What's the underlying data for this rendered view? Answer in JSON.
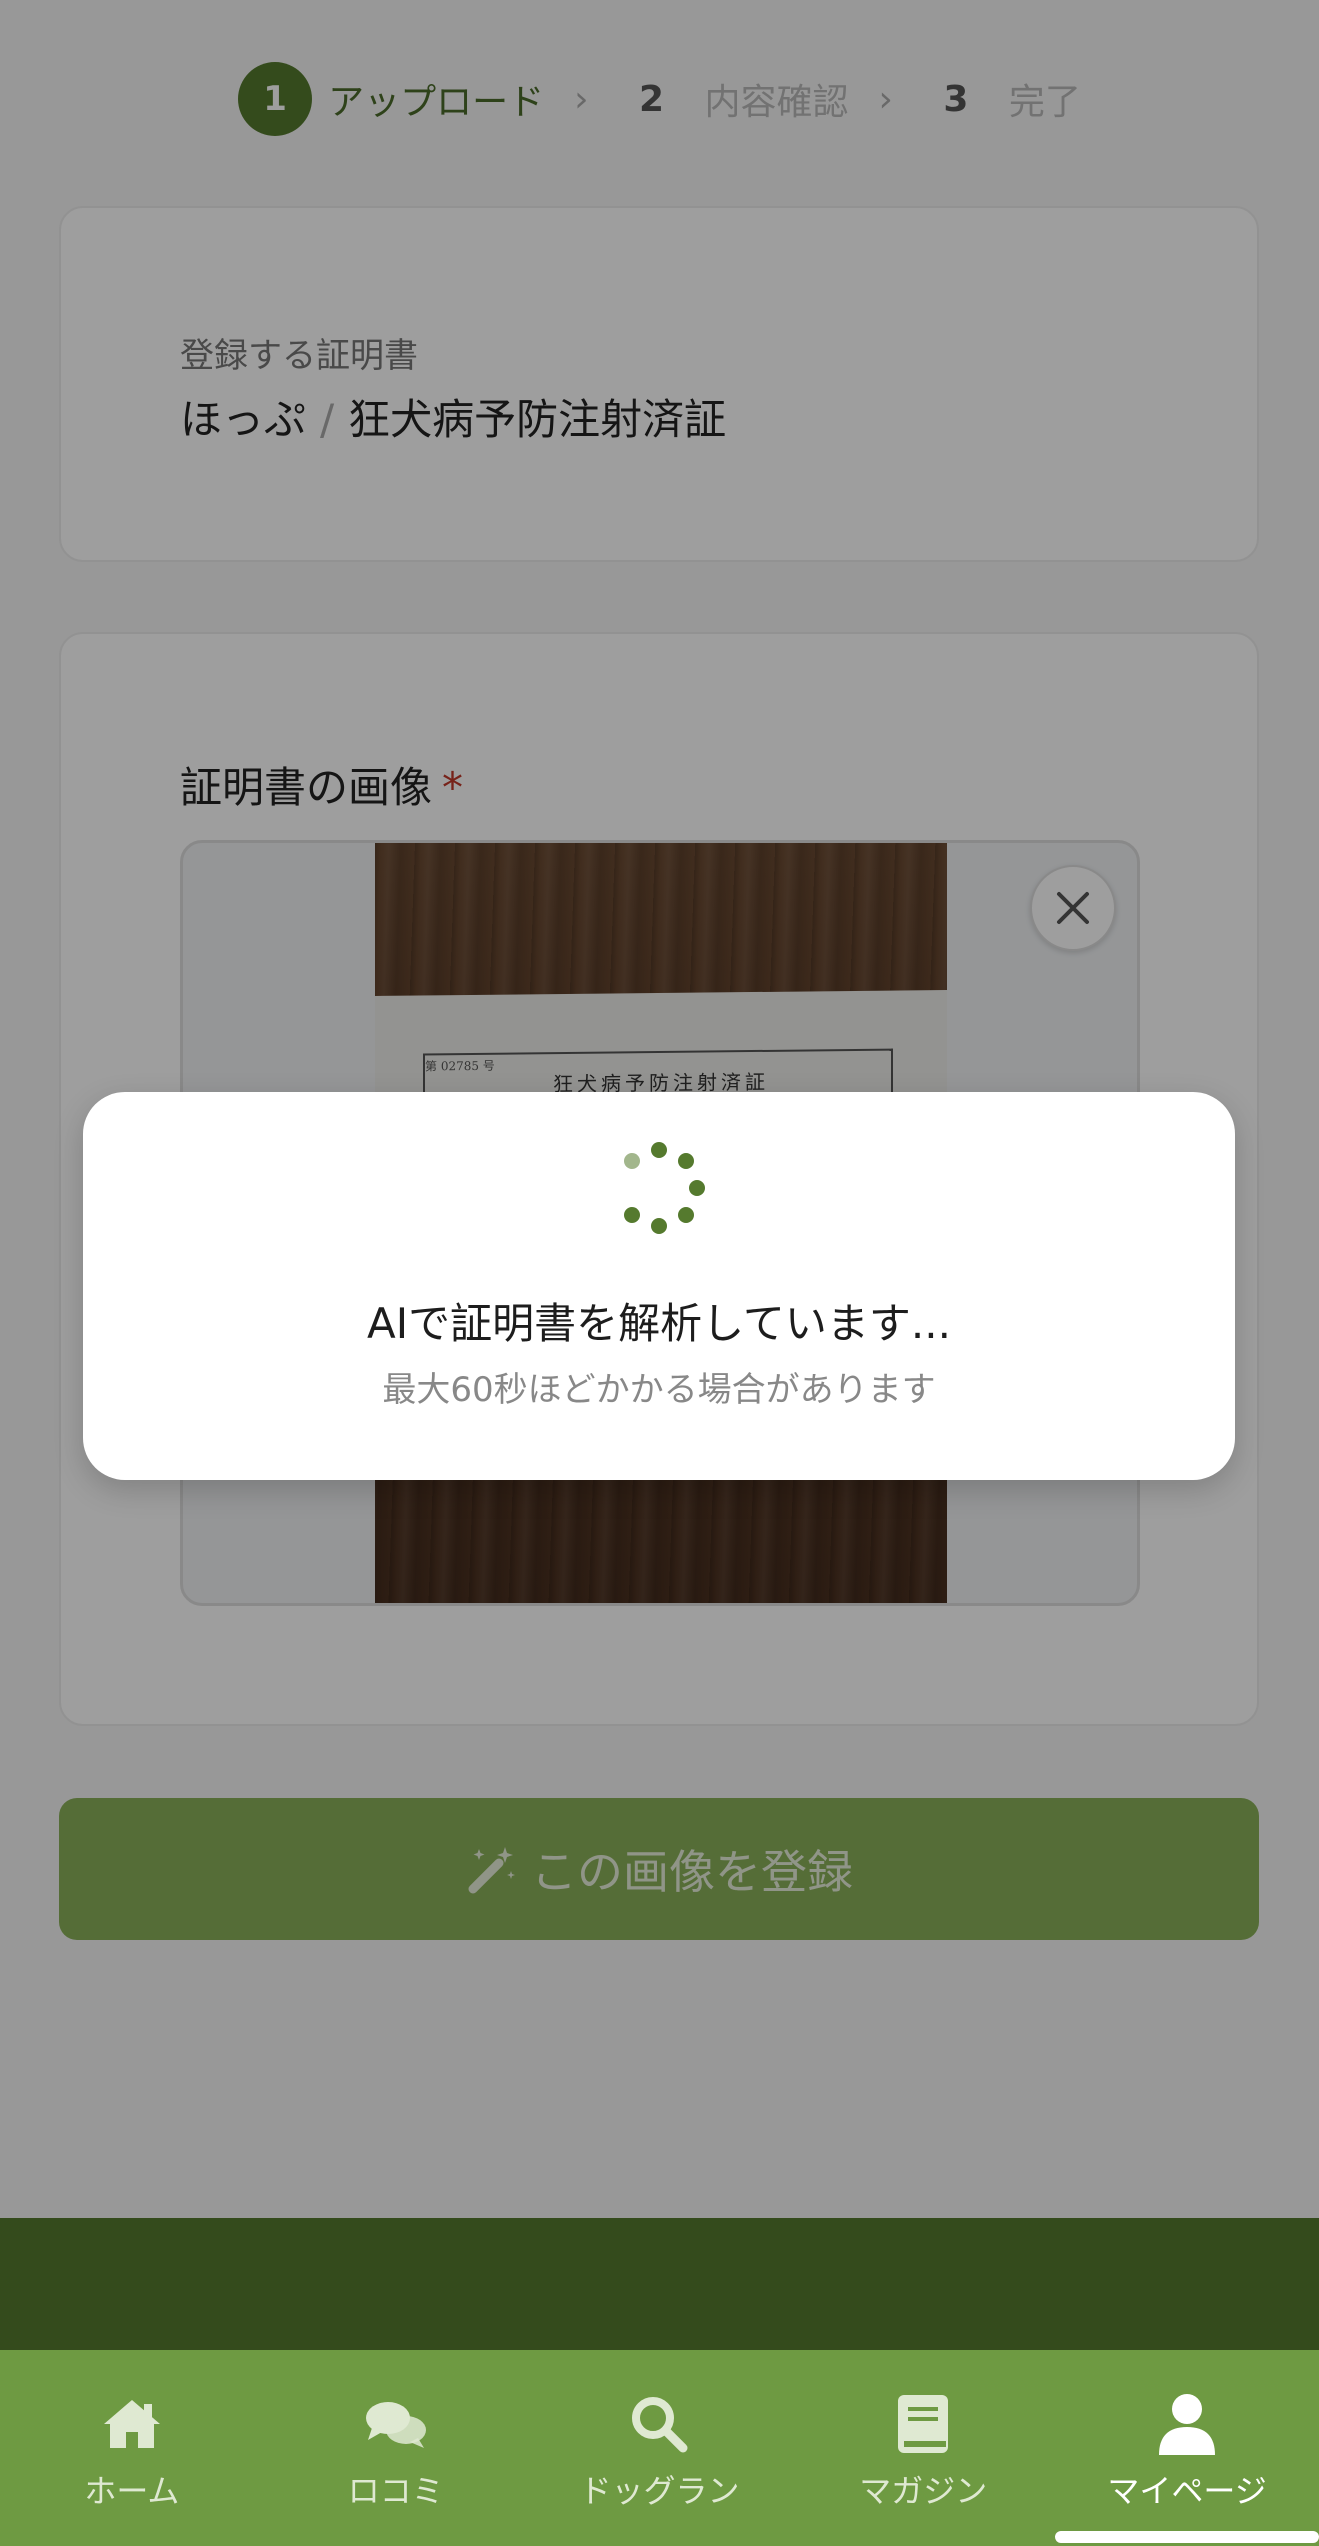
{
  "stepper": {
    "steps": [
      {
        "number": "1",
        "label": "アップロード",
        "state": "active"
      },
      {
        "number": "2",
        "label": "内容確認",
        "state": "inactive"
      },
      {
        "number": "3",
        "label": "完了",
        "state": "inactive"
      }
    ],
    "separator": "›"
  },
  "certificate": {
    "caption": "登録する証明書",
    "pet_name": "ほっぷ",
    "divider": "/",
    "document_name": "狂犬病予防注射済証"
  },
  "image_section": {
    "label": "証明書の画像",
    "required_mark": "*",
    "photo_text": {
      "doc_number": "第 02785 号",
      "doc_title": "狂犬病予防注射済証"
    },
    "remove_icon": "close-icon"
  },
  "submit": {
    "label": "この画像を登録",
    "icon": "magic-wand-icon"
  },
  "loading_modal": {
    "title": "AIで証明書を解析しています...",
    "subtitle": "最大60秒ほどかかる場合があります",
    "icon": "spinner-icon"
  },
  "bottom_nav": {
    "items": [
      {
        "label": "ホーム",
        "icon": "home-icon",
        "active": false
      },
      {
        "label": "ロコミ",
        "icon": "chat-icon",
        "active": false
      },
      {
        "label": "ドッグラン",
        "icon": "search-icon",
        "active": false
      },
      {
        "label": "マガジン",
        "icon": "book-icon",
        "active": false
      },
      {
        "label": "マイページ",
        "icon": "user-icon",
        "active": true
      }
    ]
  },
  "colors": {
    "brand": "#557a2e",
    "nav_background": "#6e9a42",
    "required": "#c0392b"
  }
}
